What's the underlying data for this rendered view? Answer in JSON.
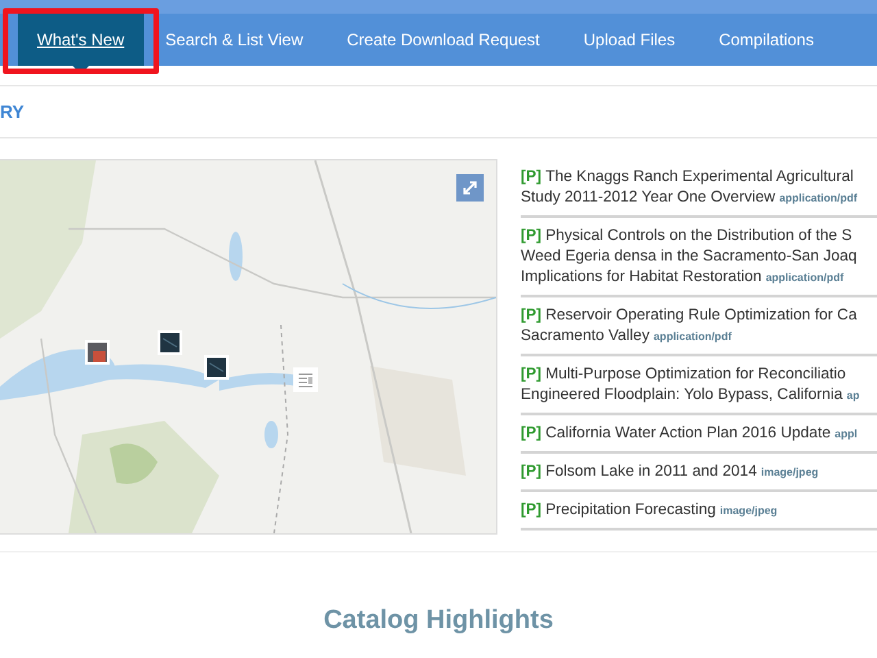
{
  "nav": {
    "tabs": [
      {
        "label": "What's New",
        "selected": true,
        "highlighted": true
      },
      {
        "label": "Search & List View",
        "selected": false,
        "highlighted": false
      },
      {
        "label": "Create Download Request",
        "selected": false,
        "highlighted": false
      },
      {
        "label": "Upload Files",
        "selected": false,
        "highlighted": false
      },
      {
        "label": "Compilations",
        "selected": false,
        "highlighted": false
      }
    ]
  },
  "section_heading": "RY",
  "map": {
    "markers": [
      {
        "kind": "photo-red"
      },
      {
        "kind": "photo-dark"
      },
      {
        "kind": "photo-dark"
      },
      {
        "kind": "document"
      }
    ]
  },
  "items": [
    {
      "tag": "[P]",
      "lines": [
        "The Knaggs Ranch Experimental Agricultural",
        "Study 2011-2012 Year One Overview"
      ],
      "type": "application/pdf"
    },
    {
      "tag": "[P]",
      "lines": [
        "Physical Controls on the Distribution of the S",
        "Weed Egeria densa in the Sacramento-San Joaq",
        "Implications for Habitat Restoration"
      ],
      "type": "application/pdf"
    },
    {
      "tag": "[P]",
      "lines": [
        "Reservoir Operating Rule Optimization for Ca",
        "Sacramento Valley"
      ],
      "type": "application/pdf"
    },
    {
      "tag": "[P]",
      "lines": [
        "Multi-Purpose Optimization for Reconciliatio",
        "Engineered Floodplain: Yolo Bypass, California"
      ],
      "type": "ap"
    },
    {
      "tag": "[P]",
      "lines": [
        "California Water Action Plan 2016 Update"
      ],
      "type": "appl"
    },
    {
      "tag": "[P]",
      "lines": [
        "Folsom Lake in 2011 and 2014"
      ],
      "type": "image/jpeg"
    },
    {
      "tag": "[P]",
      "lines": [
        "Precipitation Forecasting"
      ],
      "type": "image/jpeg"
    }
  ],
  "highlights_title": "Catalog Highlights"
}
